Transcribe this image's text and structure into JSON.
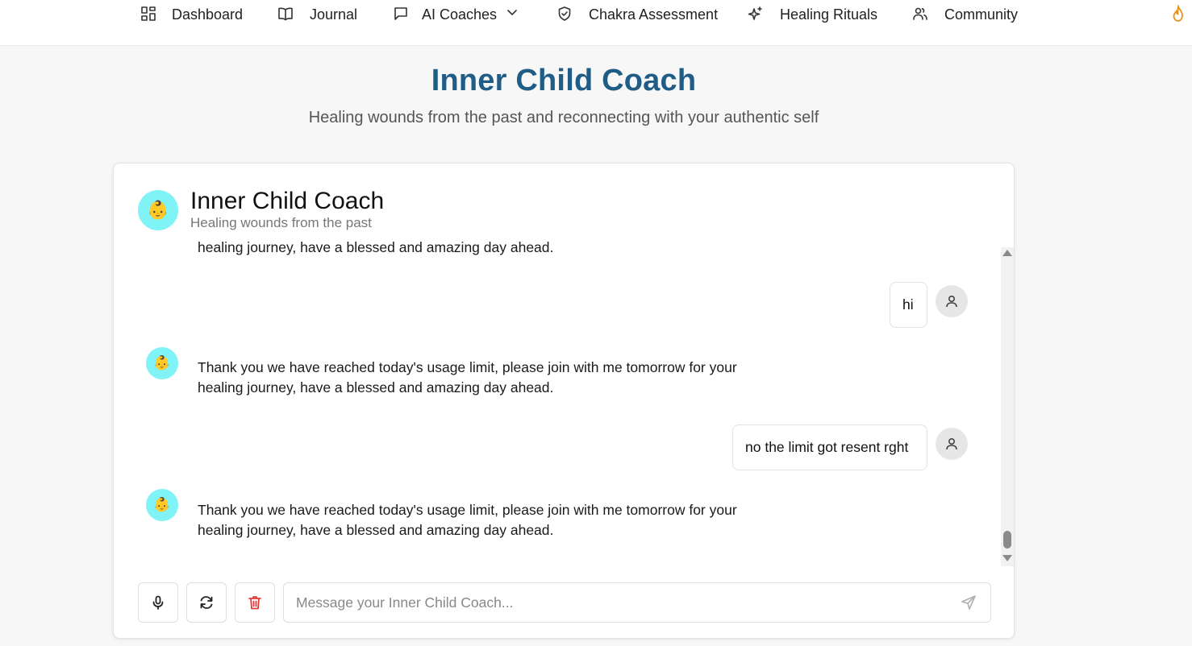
{
  "nav": {
    "items": [
      {
        "label": "Dashboard",
        "icon": "dashboard-grid-icon"
      },
      {
        "label": "Journal",
        "icon": "book-icon"
      },
      {
        "label": "AI Coaches",
        "icon": "chat-icon"
      },
      {
        "label": "Chakra Assessment",
        "icon": "shield-icon"
      },
      {
        "label": "Healing Rituals",
        "icon": "sparkles-icon"
      },
      {
        "label": "Community",
        "icon": "users-icon"
      }
    ],
    "dropdown_icon": "chevron-down-icon",
    "streak_icon": "flame-icon"
  },
  "header": {
    "title": "Inner Child Coach",
    "subtitle": "Healing wounds from the past and reconnecting with your authentic self"
  },
  "card": {
    "avatar_emoji": "👶",
    "title": "Inner Child Coach",
    "subtitle": "Healing wounds from the past"
  },
  "messages": [
    {
      "role": "bot",
      "text": "Thank you we have reached today's usage limit, please join with me tomorrow for your healing journey, have a blessed and amazing day ahead."
    },
    {
      "role": "user",
      "text": "hi"
    },
    {
      "role": "bot",
      "text": "Thank you we have reached today's usage limit, please join with me tomorrow for your healing journey, have a blessed and amazing day ahead."
    },
    {
      "role": "user",
      "text": "no the limit got resent rght"
    },
    {
      "role": "bot",
      "text": "Thank you we have reached today's usage limit, please join with me tomorrow for your healing journey, have a blessed and amazing day ahead."
    }
  ],
  "input": {
    "placeholder": "Message your Inner Child Coach...",
    "value": ""
  },
  "colors": {
    "title": "#1f5c86",
    "avatar_bg": "#7ff3f5",
    "delete": "#e23b3b",
    "streak": "#e8921a"
  }
}
